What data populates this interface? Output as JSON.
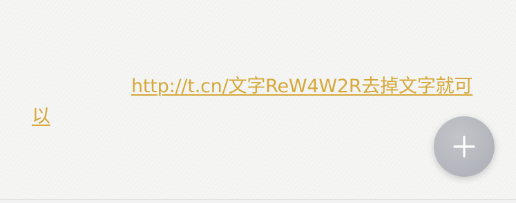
{
  "note": {
    "link_text": "http://t.cn/文字ReW4W2R去掉文字就可以"
  },
  "fab": {
    "icon": "plus-icon"
  },
  "colors": {
    "link": "#d6a83a",
    "fab_background": "#b4b7bd",
    "fab_icon": "#ffffff",
    "paper_background": "#f4f4f3"
  }
}
